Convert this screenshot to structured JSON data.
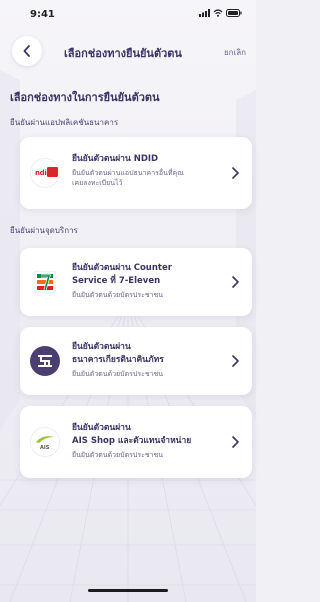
{
  "status_bar": {
    "time": "9:41"
  },
  "header": {
    "title": "เลือกช่องทางยืนยันตัวตน",
    "cancel_label": "ยกเลิก"
  },
  "page_title": "เลือกช่องทางในการยืนยันตัวตน",
  "sections": [
    {
      "label": "ยืนยันผ่านแอปพลิเคชันธนาคาร"
    },
    {
      "label": "ยืนยันผ่านจุดบริการ"
    }
  ],
  "cards": {
    "ndid": {
      "logo_text": "ndid",
      "title": "ยืนยันตัวตนผ่าน NDID",
      "desc_line1": "ยืนยันตัวตนผ่านแอปธนาคารอื่นที่คุณ",
      "desc_line2": "เคยลงทะเบียนไว้"
    },
    "seven": {
      "title_line1": "ยืนยันตัวตนผ่าน Counter",
      "title_line2": "Service ที่ 7-Eleven",
      "desc": "ยืนยันตัวตนด้วยบัตรประชาชน"
    },
    "kkp": {
      "title_line1": "ยืนยันตัวตนผ่าน",
      "title_line2": "ธนาคารเกียรตินาคินภัทร",
      "desc": "ยืนยันตัวตนด้วยบัตรประชาชน"
    },
    "ais": {
      "logo_text": "AIS",
      "title_line1": "ยืนยันตัวตนผ่าน",
      "title_line2": "AIS Shop และตัวแทนจำหน่าย",
      "desc": "ยืนยันตัวตนด้วยบัตรประชาชน"
    }
  },
  "colors": {
    "primary_text": "#3b3567",
    "accent": "#6b63a8",
    "ndid_red": "#d9262b",
    "seven_green": "#0a8a4a",
    "seven_orange": "#f26b21",
    "kkp_purple": "#4b3f72",
    "ais_green": "#9bc33b"
  }
}
